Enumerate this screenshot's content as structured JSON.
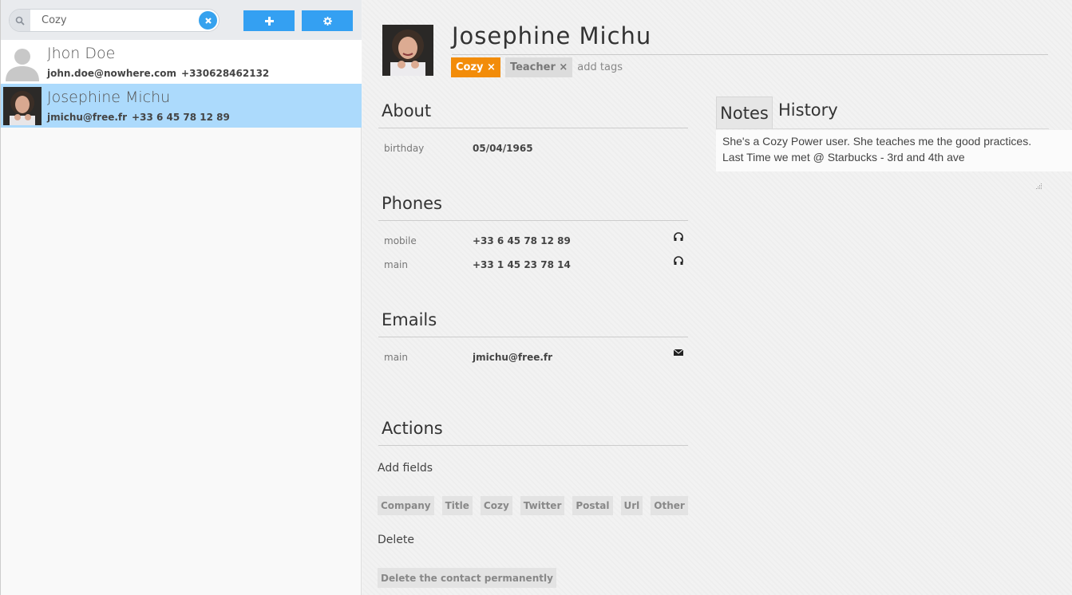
{
  "search": {
    "value": "Cozy",
    "placeholder": ""
  },
  "toolbar": {
    "add_icon": "plus-icon",
    "settings_icon": "gear-icon"
  },
  "contacts": [
    {
      "name": "Jhon Doe",
      "email": "john.doe@nowhere.com",
      "phone": "+330628462132",
      "avatar": "default-avatar"
    },
    {
      "name": "Josephine Michu",
      "email": "jmichu@free.fr",
      "phone": "+33 6 45 78 12 89",
      "avatar": "photo",
      "selected": true
    }
  ],
  "detail": {
    "name": "Josephine Michu",
    "tags": [
      {
        "label": "Cozy ×",
        "color": "#f28c0a"
      },
      {
        "label": "Teacher ×",
        "color": "#dcdcdc"
      }
    ],
    "add_tags_placeholder": "add tags",
    "about": {
      "title": "About",
      "fields": [
        {
          "label": "birthday",
          "value": "05/04/1965"
        }
      ]
    },
    "phones": {
      "title": "Phones",
      "fields": [
        {
          "label": "mobile",
          "value": "+33 6 45 78 12 89",
          "icon": "headphones-icon"
        },
        {
          "label": "main",
          "value": "+33 1 45 23 78 14",
          "icon": "headphones-icon"
        }
      ]
    },
    "emails": {
      "title": "Emails",
      "fields": [
        {
          "label": "main",
          "value": "jmichu@free.fr",
          "icon": "envelope-icon"
        }
      ]
    },
    "actions": {
      "title": "Actions",
      "add_fields_label": "Add fields",
      "field_buttons": [
        "Company",
        "Title",
        "Cozy",
        "Twitter",
        "Postal",
        "Url",
        "Other"
      ],
      "delete_label": "Delete",
      "delete_button": "Delete the contact permanently"
    },
    "tabs": {
      "notes": "Notes",
      "history": "History"
    },
    "notes_text_line1": "She's a Cozy Power user. She teaches me the good practices.",
    "notes_text_line2": "Last Time we met @ Starbucks - 3rd and 4th ave"
  },
  "colors": {
    "accent": "#34a0f2",
    "selected_row": "#acdafc",
    "tag_cozy": "#f28c0a"
  }
}
